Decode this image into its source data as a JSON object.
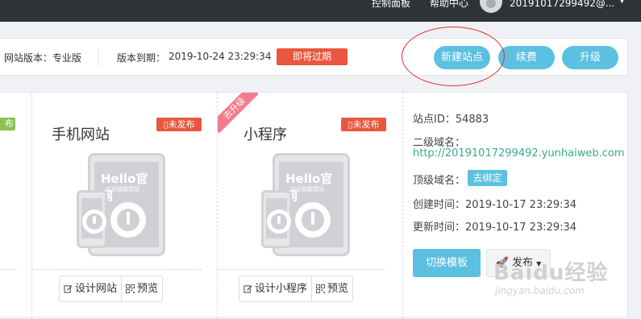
{
  "topbar": {
    "control_panel": "控制面板",
    "help_center": "帮助中心",
    "user": "20191017299492@..."
  },
  "infobar": {
    "site_version": "网站版本：专业版",
    "expire_label": "版本到期：",
    "expire_value": "2019-10-24 23:29:34",
    "expire_badge": "即将过期",
    "new_site": "新建站点",
    "renew": "续费",
    "upgrade": "升级"
  },
  "cards": {
    "left_badge": "布",
    "mobile": {
      "title": "手机网站",
      "badge": "未发布",
      "design": "设计网站",
      "preview": "预览"
    },
    "miniapp": {
      "title": "小程序",
      "badge": "未发布",
      "ribbon": "去升级",
      "design": "设计小程序",
      "preview": "预览"
    },
    "mock": {
      "hello": "Hello官网",
      "sub": "企业智能建站"
    }
  },
  "site_info": {
    "site_id": "站点ID：54883",
    "subdomain_label": "二级域名：",
    "subdomain_value": "http://20191017299492.yunhaiweb.com",
    "topdomain_label": "顶级域名：",
    "bind": "去绑定",
    "created": "创建时间：2019-10-17 23:29:34",
    "updated": "更新时间：2019-10-17 23:29:34",
    "switch_template": "切换模板",
    "publish": "发布"
  },
  "watermark": {
    "brand": "Baidu经验",
    "url": "jingyan.baidu.com"
  },
  "colors": {
    "accent": "#5cc0e0",
    "danger": "#e9573f",
    "link": "#3aab8b",
    "topbar": "#2f3237"
  }
}
